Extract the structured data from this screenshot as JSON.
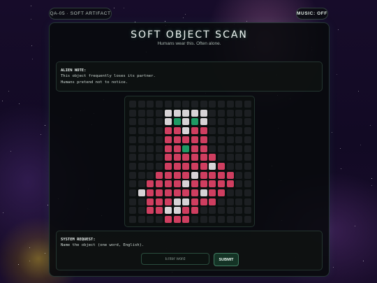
{
  "header": {
    "tag": "QA-05 · SOFT ARTIFACT",
    "music_toggle": "MUSIC: OFF"
  },
  "panel": {
    "title": "SOFT OBJECT SCAN",
    "subtitle": "Humans wear this. Often alone."
  },
  "alien_note": {
    "label": "ALIEN NOTE:",
    "lines": [
      "This object frequently loses its partner.",
      "Humans pretend not to notice."
    ]
  },
  "pixel_grid": {
    "columns": 14,
    "rows": 14,
    "palette": {
      "0": "#1c1f22",
      "1": "#d7d3d6",
      "2": "#cf3e60",
      "3": "#1f9a64"
    },
    "cells": [
      "00000000000000",
      "00001111100000",
      "00001313100000",
      "00002212200000",
      "00002222200000",
      "00002232200000",
      "00002222220000",
      "00002222212000",
      "00022221222200",
      "00222212222200",
      "01222222122000",
      "00222112220000",
      "00221122000000",
      "00002220000000"
    ]
  },
  "system_request": {
    "label": "SYSTEM REQUEST:",
    "prompt": "Name the object (one word, English).",
    "input_placeholder": "Enter word",
    "input_value": "",
    "submit_label": "SUBMIT"
  }
}
